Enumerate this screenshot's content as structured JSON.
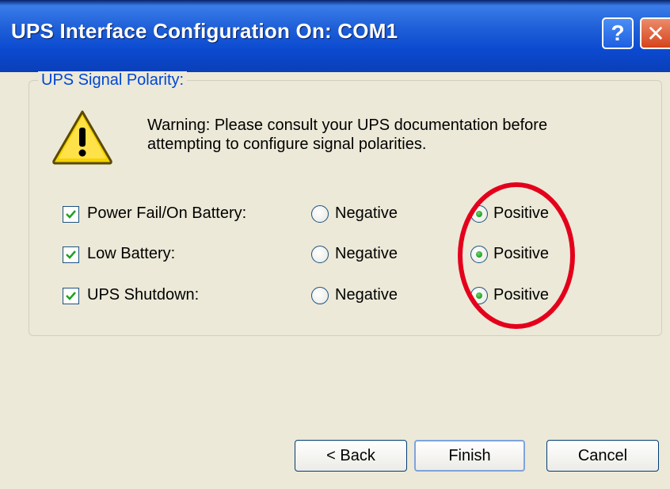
{
  "window": {
    "title": "UPS Interface Configuration On: COM1",
    "help_label": "?",
    "close_label": "✕"
  },
  "group": {
    "label": "UPS Signal Polarity:"
  },
  "warning": {
    "line1": "Warning: Please consult your UPS documentation before",
    "line2": "attempting to configure signal polarities.",
    "icon": "warning-icon"
  },
  "rows": [
    {
      "label": "Power Fail/On Battery:",
      "checked": true,
      "negative": "Negative",
      "positive": "Positive",
      "selected": "Positive"
    },
    {
      "label": "Low Battery:",
      "checked": true,
      "negative": "Negative",
      "positive": "Positive",
      "selected": "Positive"
    },
    {
      "label": "UPS Shutdown:",
      "checked": true,
      "negative": "Negative",
      "positive": "Positive",
      "selected": "Positive"
    }
  ],
  "buttons": {
    "back": "< Back",
    "finish": "Finish",
    "cancel": "Cancel"
  },
  "colors": {
    "titlebar": "#0b4ad0",
    "group_label": "#0046d5",
    "annotation": "#e4001b",
    "check_green": "#21a121"
  }
}
